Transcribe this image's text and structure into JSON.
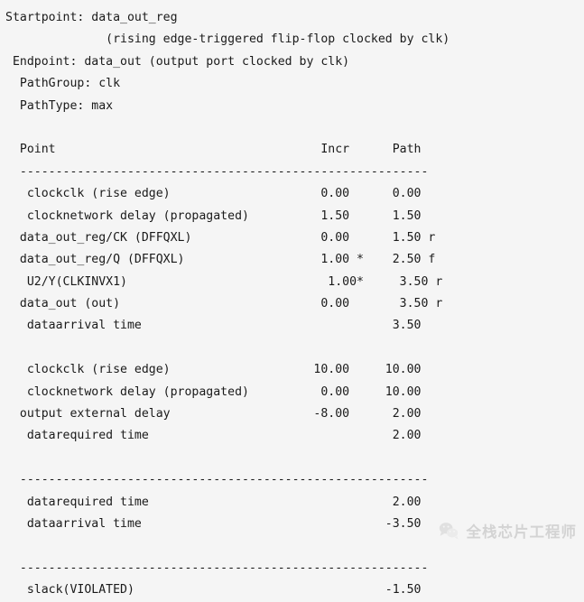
{
  "report": {
    "type": "timing-report",
    "header": {
      "startpoint_line": "Startpoint: data_out_reg",
      "startpoint_detail_line": "              (rising edge-triggered flip-flop clocked by clk)",
      "endpoint_line": " Endpoint: data_out (output port clocked by clk)",
      "path_group_line": "  PathGroup: clk",
      "path_type_line": "  PathType: max"
    },
    "columns": {
      "point": "Point",
      "incr": "Incr",
      "path": "Path",
      "header_line": "  Point                                     Incr      Path"
    },
    "separator": "  ---------------------------------------------------------",
    "arrival_section": [
      "   clockclk (rise edge)                     0.00      0.00",
      "   clocknetwork delay (propagated)          1.50      1.50",
      "  data_out_reg/CK (DFFQXL)                  0.00      1.50 r",
      "  data_out_reg/Q (DFFQXL)                   1.00 *    2.50 f",
      "   U2/Y(CLKINVX1)                            1.00*     3.50 r",
      "  data_out (out)                            0.00       3.50 r",
      "   dataarrival time                                   3.50"
    ],
    "required_section": [
      "   clockclk (rise edge)                    10.00     10.00",
      "   clocknetwork delay (propagated)          0.00     10.00",
      "  output external delay                    -8.00      2.00",
      "   datarequired time                                  2.00"
    ],
    "summary_section": [
      "   datarequired time                                  2.00",
      "   dataarrival time                                  -3.50"
    ],
    "slack_line": "   slack(VIOLATED)                                   -1.50",
    "values": {
      "startpoint": "data_out_reg",
      "startpoint_detail": "(rising edge-triggered flip-flop clocked by clk)",
      "endpoint": "data_out (output port clocked by clk)",
      "path_group": "clk",
      "path_type": "max",
      "data_arrival_time": "3.50",
      "data_required_time": "2.00",
      "data_arrival_time_negated": "-3.50",
      "slack": "-1.50",
      "slack_status": "VIOLATED",
      "clock_period": "10.00",
      "clock_network_delay": "1.50",
      "output_external_delay": "-8.00"
    },
    "colors": {
      "background": "#f5f5f5",
      "text": "#1a1a1a",
      "watermark": "#b9b9b9"
    }
  },
  "watermark": {
    "text": "全栈芯片工程师",
    "icon": "wechat-logo-icon"
  }
}
